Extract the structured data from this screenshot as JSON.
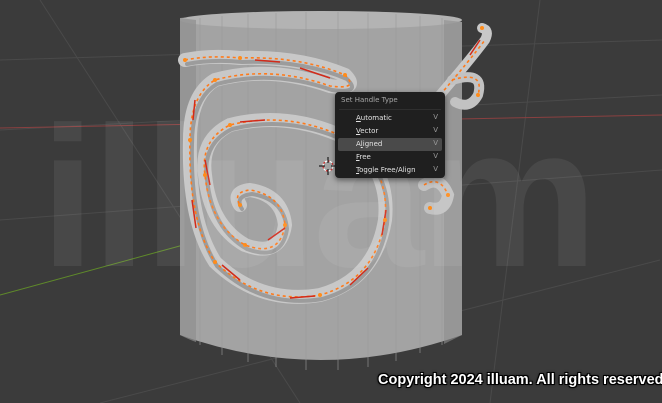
{
  "viewport": {
    "watermark": "illuam",
    "copyright": "Copyright 2024 illuam. All rights reserved."
  },
  "context_menu": {
    "title": "Set Handle Type",
    "items": [
      {
        "label": "Automatic",
        "shortcut": "A",
        "rest": "utomatic",
        "shortcut_icon": "checkmark-icon",
        "active": false
      },
      {
        "label": "Vector",
        "shortcut": "V",
        "rest": "ector",
        "shortcut_icon": "checkmark-icon",
        "active": false
      },
      {
        "label": "Aligned",
        "shortcut": "l",
        "prefix": "A",
        "rest": "igned",
        "shortcut_icon": "checkmark-icon",
        "active": true
      },
      {
        "label": "Free",
        "shortcut": "F",
        "rest": "ree",
        "shortcut_icon": "checkmark-icon",
        "active": false
      },
      {
        "label": "Toggle Free/Align",
        "shortcut": "T",
        "rest": "oggle Free/Align",
        "shortcut_icon": "checkmark-icon",
        "active": false
      }
    ]
  },
  "colors": {
    "background": "#3b3b3b",
    "mesh": "#a6a6a6",
    "curve_points": "#ff7a1a",
    "curve_handles": "#d22a1a",
    "menu_bg": "#1f1f1f",
    "menu_highlight": "#4a4a4a"
  }
}
